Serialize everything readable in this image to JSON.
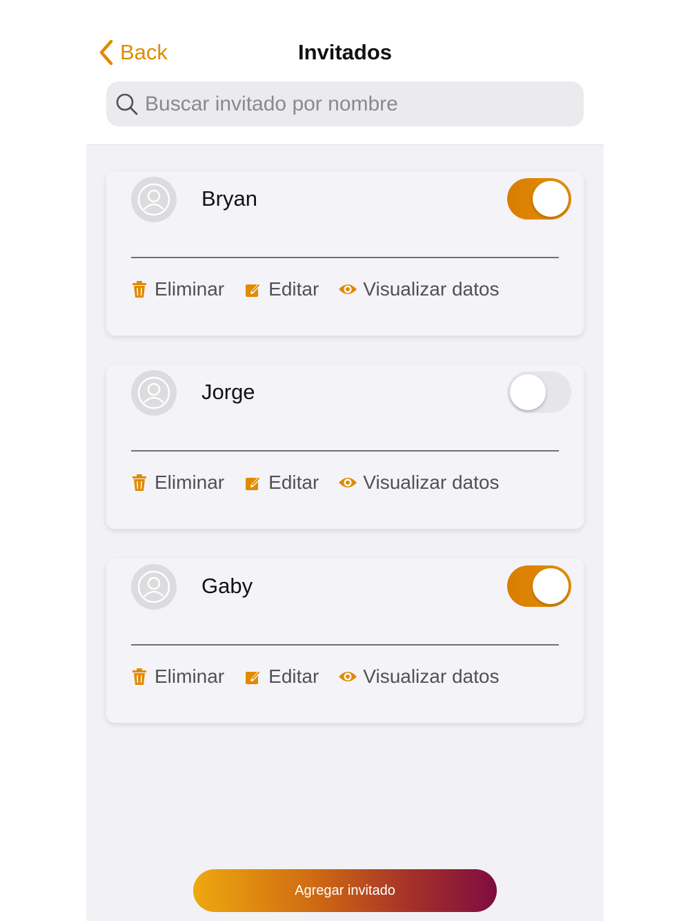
{
  "header": {
    "back_label": "Back",
    "title": "Invitados"
  },
  "search": {
    "placeholder": "Buscar invitado por nombre",
    "value": ""
  },
  "guests": [
    {
      "name": "Bryan",
      "confirmed": true,
      "actions": {
        "delete": "Eliminar",
        "edit": "Editar",
        "view": "Visualizar datos"
      }
    },
    {
      "name": "Jorge",
      "confirmed": false,
      "actions": {
        "delete": "Eliminar",
        "edit": "Editar",
        "view": "Visualizar datos"
      }
    },
    {
      "name": "Gaby",
      "confirmed": true,
      "actions": {
        "delete": "Eliminar",
        "edit": "Editar",
        "view": "Visualizar datos"
      }
    }
  ],
  "footer": {
    "add_label": "Agregar invitado"
  },
  "colors": {
    "accent": "#e08a00",
    "toggle_on": "#e08a00",
    "toggle_off": "#e6e5ea",
    "button_gradient_start": "#eda90f",
    "button_gradient_end": "#7f0c40"
  },
  "icons": {
    "back": "chevron-left-icon",
    "search": "magnifier-icon",
    "avatar": "user-avatar-icon",
    "delete": "trash-icon",
    "edit": "edit-icon",
    "view": "eye-icon"
  }
}
